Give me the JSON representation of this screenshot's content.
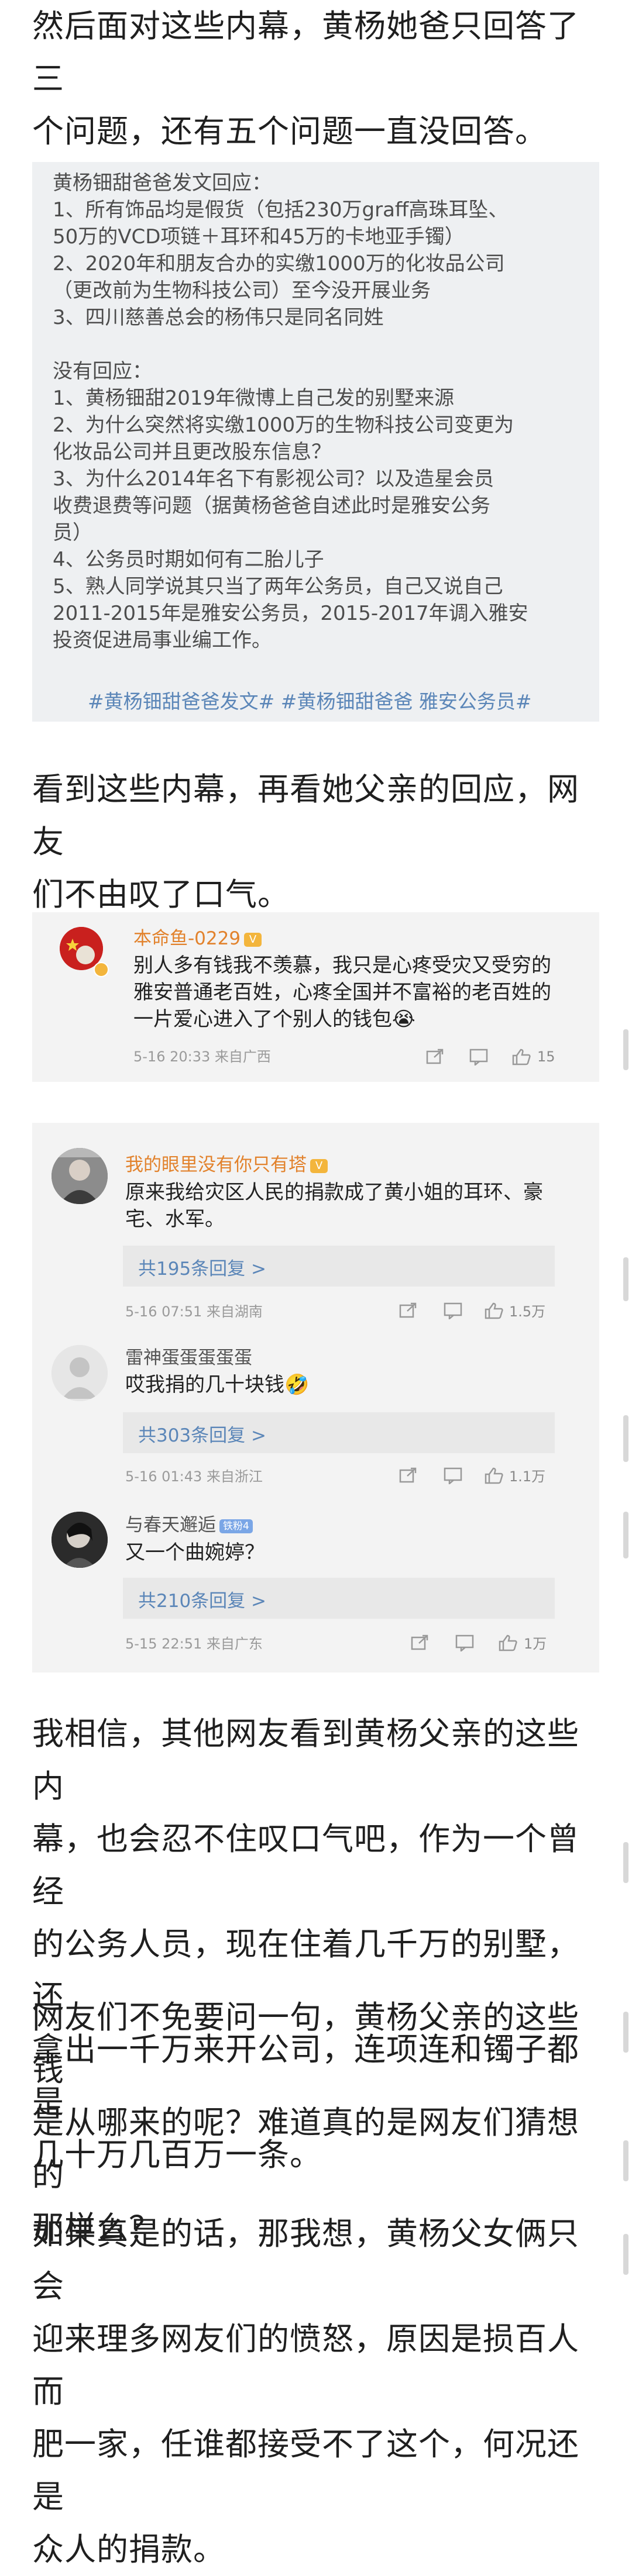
{
  "paragraphs": {
    "p1": "然后面对这些内幕，黄杨她爸只回答了三\n个问题，还有五个问题一直没回答。",
    "p2": "看到这些内幕，再看她父亲的回应，网友\n们不由叹了口气。",
    "p3": "我相信，其他网友看到黄杨父亲的这些内\n幕，也会忍不住叹口气吧，作为一个曾经\n的公务人员，现在住着几千万的别墅，还\n拿出一千万来开公司，连项连和镯子都是\n几十万几百万一条。",
    "p4": "网友们不免要问一句，黄杨父亲的这些钱\n是从哪来的呢？难道真的是网友们猜想的\n那样么？",
    "p5": "如果真是的话，那我想，黄杨父女俩只会\n迎来理多网友们的愤怒，原因是损百人而\n肥一家，任谁都接受不了这个，何况还是\n众人的捐款。"
  },
  "notice": {
    "body": "黄杨钿甜爸爸发文回应：\n1、所有饰品均是假货（包括230万graff高珠耳坠、\n50万的VCD项链＋耳环和45万的卡地亚手镯）\n2、2020年和朋友合办的实缴1000万的化妆品公司\n（更改前为生物科技公司）至今没开展业务\n3、四川慈善总会的杨伟只是同名同姓\n\n没有回应：\n1、黄杨钿甜2019年微博上自己发的别墅来源\n2、为什么突然将实缴1000万的生物科技公司变更为\n化妆品公司并且更改股东信息？\n3、为什么2014年名下有影视公司？以及造星会员\n收费退费等问题（据黄杨爸爸自述此时是雅安公务\n员）\n4、公务员时期如何有二胎儿子\n5、熟人同学说其只当了两年公务员，自己又说自己\n2011-2015年是雅安公务员，2015-2017年调入雅安\n投资促进局事业编工作。",
    "tags": "#黄杨钿甜爸爸发文# #黄杨钿甜爸爸 雅安公务员#"
  },
  "comment_single": {
    "username": "本命鱼-0229",
    "badge": "V",
    "text": "别人多有钱我不羡慕，我只是心疼受灾又受穷的\n雅安普通老百姓，心疼全国并不富裕的老百姓的\n一片爱心进入了个别人的钱包😭",
    "meta": "5-16 20:33  来自广西",
    "likes": "15"
  },
  "comment_thread": [
    {
      "username": "我的眼里没有你只有塔",
      "badge": "V",
      "text": "原来我给灾区人民的捐款成了黄小姐的耳环、豪\n宅、水军。",
      "replies": "共195条回复 >",
      "meta": "5-16 07:51  来自湖南",
      "likes": "1.5万"
    },
    {
      "username": "雷神蛋蛋蛋蛋蛋",
      "badge": "",
      "text": "哎我捐的几十块钱🤣",
      "replies": "共303条回复 >",
      "meta": "5-16 01:43  来自浙江",
      "likes": "1.1万"
    },
    {
      "username": "与春天邂逅",
      "badge": "铁粉4",
      "text": "又一个曲婉婷？",
      "replies": "共210条回复 >",
      "meta": "5-15 22:51  来自广东",
      "likes": "1万"
    }
  ],
  "colors": {
    "username_orange": "#e2822c",
    "username_gray": "#555555",
    "link_blue": "#5b86b8",
    "notice_bg": "#eef0f2",
    "comment_bg": "#f3f3f3"
  },
  "icons": [
    "share-icon",
    "comment-icon",
    "like-icon"
  ]
}
